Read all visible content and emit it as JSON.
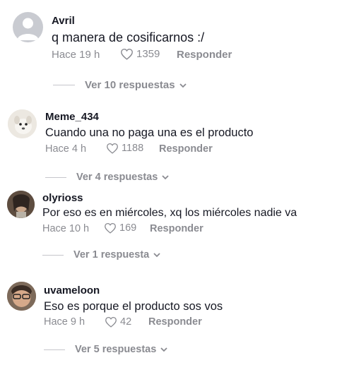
{
  "comments": [
    {
      "username": "Avril",
      "text": "q manera de cosificarnos :/",
      "time": "Hace 19 h",
      "likes": "1359",
      "reply_label": "Responder",
      "more_replies": "Ver 10 respuestas"
    },
    {
      "username": "Meme_434",
      "text": "Cuando una no paga una es el producto",
      "time": "Hace 4 h",
      "likes": "1188",
      "reply_label": "Responder",
      "more_replies": "Ver 4 respuestas"
    },
    {
      "username": "olyrioss",
      "text": "Por eso es en miércoles, xq los miércoles nadie va",
      "time": "Hace 10 h",
      "likes": "169",
      "reply_label": "Responder",
      "more_replies": "Ver 1 respuesta"
    },
    {
      "username": "uvameloon",
      "text": "Eso es porque el producto sos vos",
      "time": "Hace 9 h",
      "likes": "42",
      "reply_label": "Responder",
      "more_replies": "Ver 5 respuestas"
    }
  ],
  "icons": {
    "heart": "heart-outline-icon",
    "chevron": "chevron-down-icon",
    "avatar_default": "default-avatar-icon"
  },
  "colors": {
    "text_primary": "#161823",
    "text_secondary": "#8a8b91",
    "default_avatar": "#c9cbd1"
  }
}
